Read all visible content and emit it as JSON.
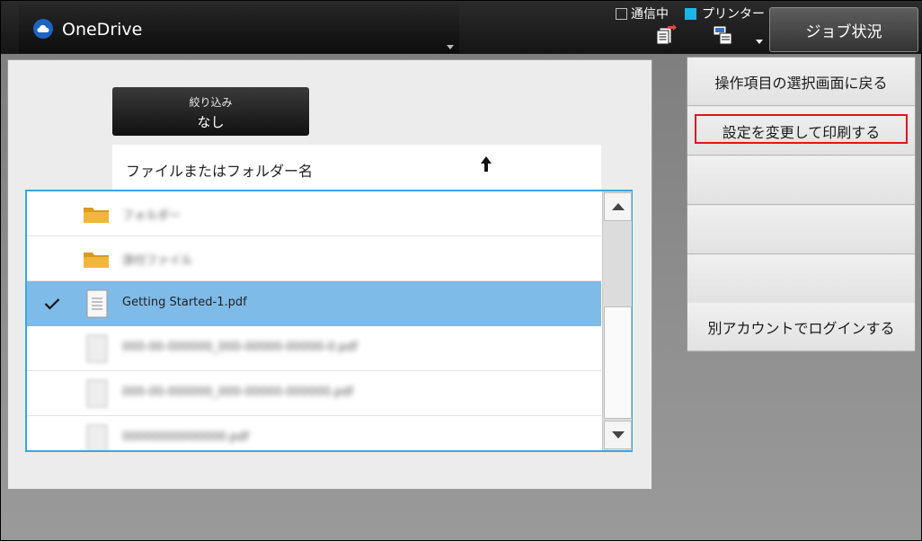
{
  "header": {
    "app_title": "OneDrive",
    "comm_status_label": "通信中",
    "printer_status_label": "プリンター",
    "job_status_label": "ジョブ状況"
  },
  "filter": {
    "label": "絞り込み",
    "value": "なし"
  },
  "file_list": {
    "column_header": "ファイルまたはフォルダー名",
    "rows": [
      {
        "type": "folder",
        "name": "フォルダー",
        "selected": false,
        "blurred": true
      },
      {
        "type": "folder",
        "name": "添付ファイル",
        "selected": false,
        "blurred": true
      },
      {
        "type": "file",
        "name": "Getting Started-1.pdf",
        "selected": true,
        "blurred": false
      },
      {
        "type": "file",
        "name": "000-00-000000_000-00000-00000-0.pdf",
        "selected": false,
        "blurred": true
      },
      {
        "type": "file",
        "name": "000-00-000000_000-00000-000000.pdf",
        "selected": false,
        "blurred": true
      },
      {
        "type": "file",
        "name": "00000000000000.pdf",
        "selected": false,
        "blurred": true
      }
    ]
  },
  "right_menu": {
    "items": [
      {
        "label": "操作項目の選択画面に戻る"
      },
      {
        "label": "設定を変更して印刷する"
      },
      {
        "label": ""
      },
      {
        "label": ""
      },
      {
        "label": ""
      },
      {
        "label": "別アカウントでログインする"
      }
    ]
  },
  "colors": {
    "selected_row": "#7ebbe8",
    "list_border": "#3aa6e0",
    "highlight_box": "#e0141c",
    "printer_status": "#1ab7e6"
  }
}
